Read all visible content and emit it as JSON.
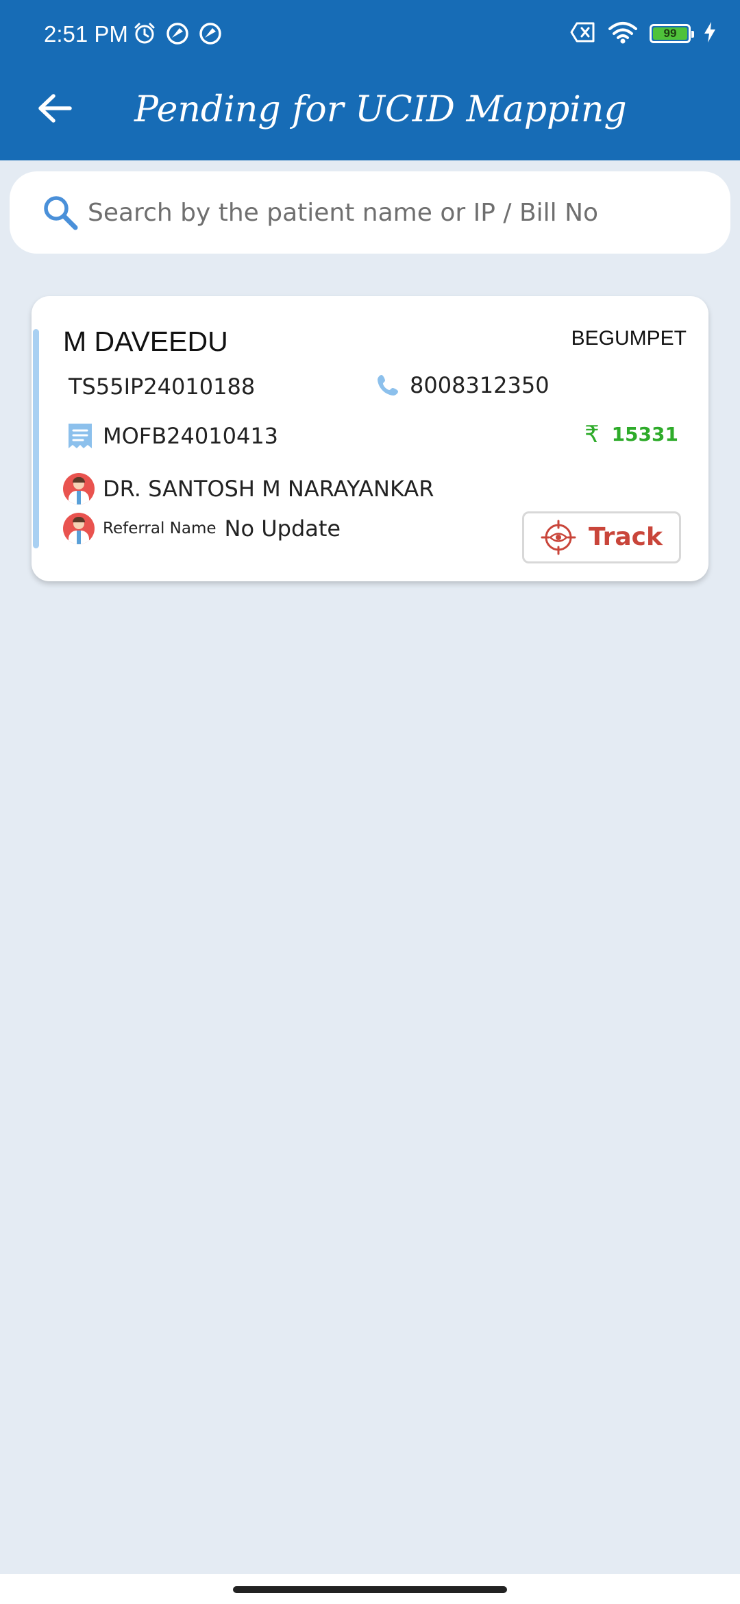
{
  "status_bar": {
    "time": "2:51 PM",
    "battery_level": "99"
  },
  "header": {
    "title": "Pending for UCID Mapping"
  },
  "search": {
    "placeholder": "Search by the patient name or IP / Bill No"
  },
  "card": {
    "patient_name": "M DAVEEDU",
    "location": "BEGUMPET",
    "ip_number": "TS55IP24010188",
    "phone": "8008312350",
    "bill_number": "MOFB24010413",
    "amount": "15331",
    "currency_symbol": "₹",
    "doctor": "DR. SANTOSH M NARAYANKAR",
    "referral_label": "Referral Name",
    "referral_value": "No Update",
    "track_label": "Track"
  },
  "colors": {
    "header_bg": "#176cb6",
    "page_bg": "#e4ebf3",
    "amount_green": "#2eab2a",
    "track_red": "#c9453a",
    "accent_bar": "#a9d0f2"
  },
  "icons": {
    "back": "arrow-left-icon",
    "search": "magnifier-icon",
    "phone": "phone-icon",
    "bill": "receipt-icon",
    "currency": "rupee-icon",
    "doctor": "doctor-avatar-icon",
    "track": "target-eye-icon"
  }
}
